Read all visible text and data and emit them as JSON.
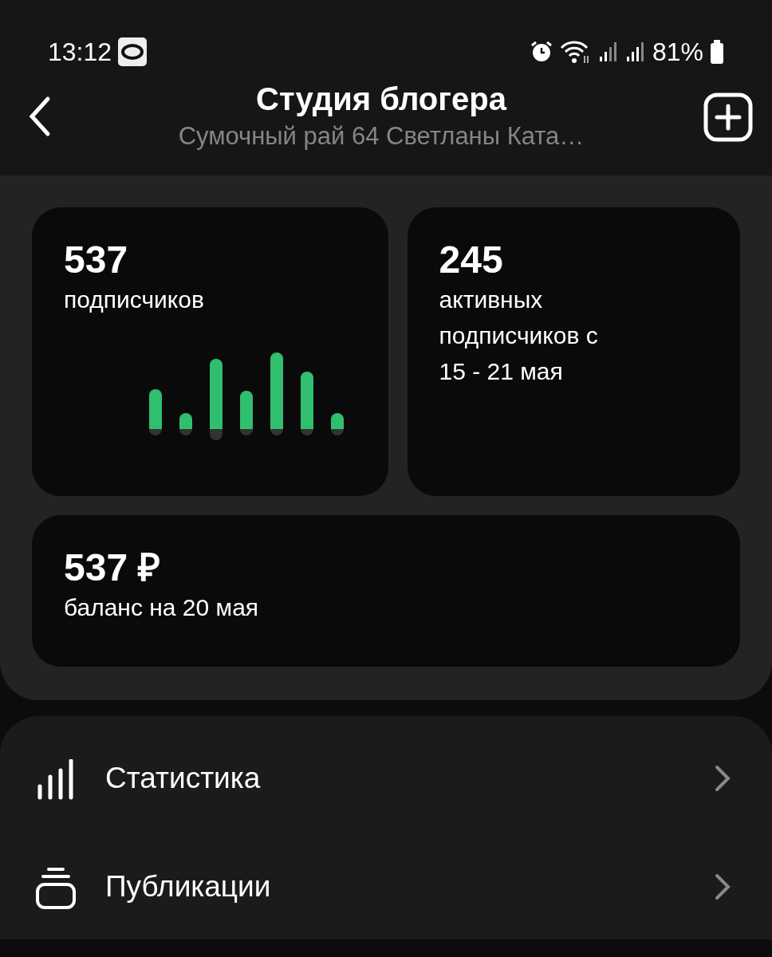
{
  "status_bar": {
    "time": "13:12",
    "battery": "81%"
  },
  "header": {
    "title": "Студия блогера",
    "subtitle": "Сумочный рай 64 Светланы Ката…"
  },
  "stats": [
    {
      "value": "537",
      "label": "подписчиков"
    },
    {
      "value": "245",
      "label": "активных подписчиков с 15 - 21 мая"
    },
    {
      "value": "537 ₽",
      "label": "баланс на 20 мая"
    }
  ],
  "menu": [
    {
      "label": "Статистика"
    },
    {
      "label": "Публикации"
    }
  ]
}
